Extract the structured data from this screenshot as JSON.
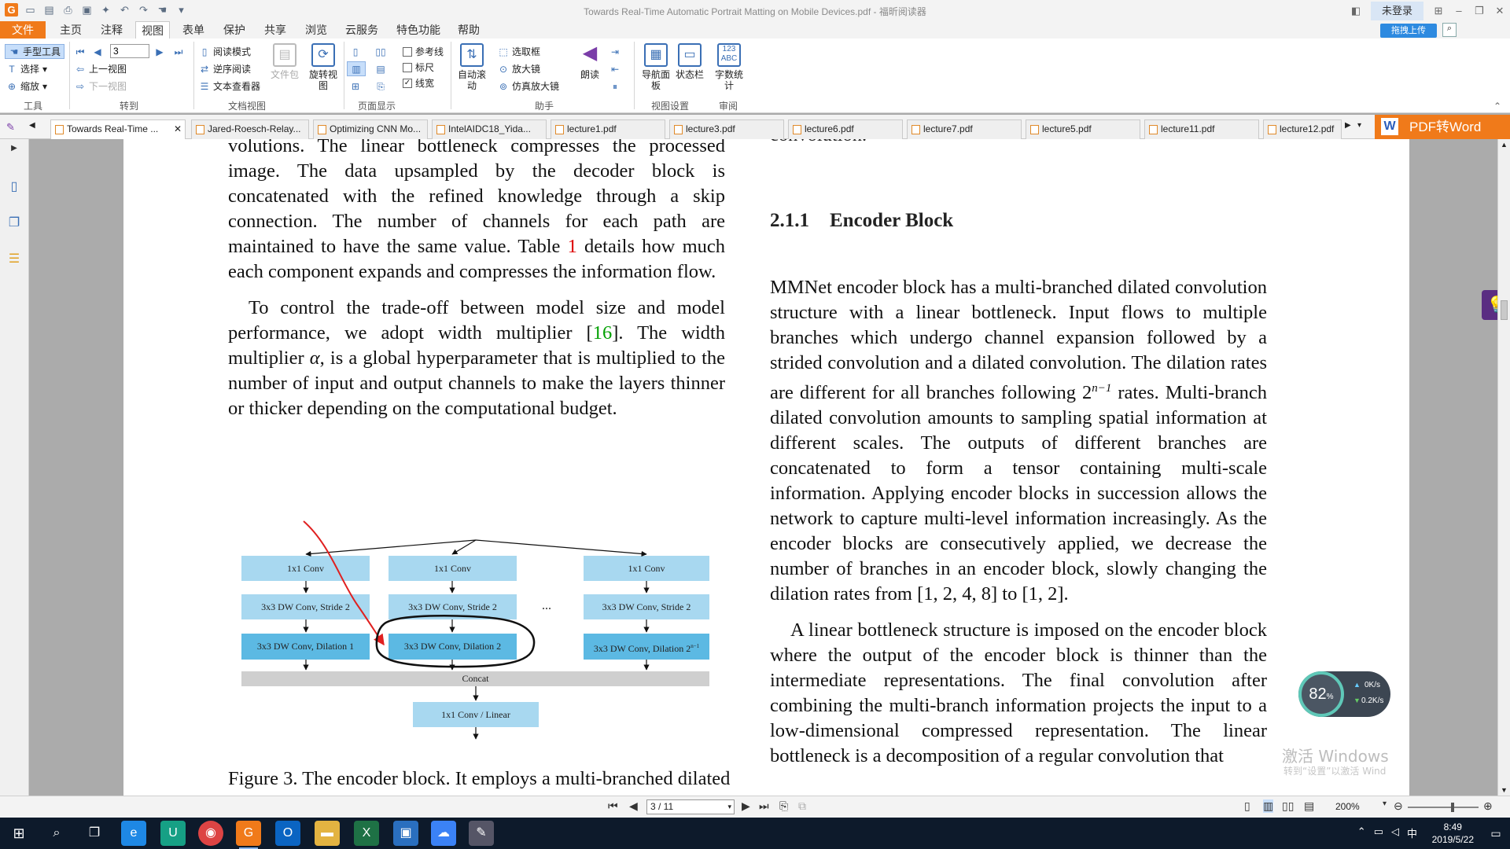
{
  "window": {
    "title": "Towards Real-Time Automatic Portrait Matting on Mobile Devices.pdf - 福昕阅读器",
    "login_label": "未登录",
    "upload_label": "拖拽上传"
  },
  "menu": {
    "tabs": [
      "文件",
      "主页",
      "注释",
      "视图",
      "表单",
      "保护",
      "共享",
      "浏览",
      "云服务",
      "特色功能",
      "帮助"
    ],
    "active": "视图"
  },
  "ribbon": {
    "tools": {
      "hand": "手型工具",
      "select": "选择",
      "zoom": "缩放",
      "group": "工具"
    },
    "goto": {
      "page_value": "3",
      "prev_view": "上一视图",
      "next_view": "下一视图",
      "group": "转到"
    },
    "docview": {
      "read_mode": "阅读模式",
      "reverse_read": "逆序阅读",
      "text_viewer": "文本查看器",
      "file_pkg": "文件包",
      "rotate": "旋转视图",
      "group": "文档视图"
    },
    "pagedisplay": {
      "guides": "参考线",
      "ruler": "标尺",
      "linewidth": "线宽",
      "group": "页面显示"
    },
    "assist": {
      "auto_scroll": "自动滚动",
      "select_box": "选取框",
      "magnifier": "放大镜",
      "loupe": "仿真放大镜",
      "read_aloud": "朗读",
      "group": "助手"
    },
    "viewsettings": {
      "nav_panel": "导航面板",
      "status_bar": "状态栏",
      "word_count": "字数统计",
      "group": "视图设置",
      "group2": "审阅",
      "abc": "123 ABC"
    }
  },
  "doc_tabs": [
    "Towards Real-Time ...",
    "Jared-Roesch-Relay...",
    "Optimizing CNN Mo...",
    "IntelAIDC18_Yida...",
    "lecture1.pdf",
    "lecture3.pdf",
    "lecture6.pdf",
    "lecture7.pdf",
    "lecture5.pdf",
    "lecture11.pdf",
    "lecture12.pdf"
  ],
  "pdf_to_word": "PDF转Word",
  "document": {
    "left_para1": [
      "volutions. The linear bottleneck compresses the processed image. The data upsampled by the decoder block is concatenated with the refined knowledge through a skip connection. The number of channels for each path are maintained to have the same value. Table ",
      "1",
      " details how much each component expands and compresses the information flow."
    ],
    "left_para2": [
      "To control the trade-off between model size and model performance, we adopt width multiplier [",
      "16",
      "]. The width multiplier ",
      "α",
      ", is a global hyperparameter that is multiplied to the number of input and output channels to make the layers thinner or thicker depending on the computational budget."
    ],
    "top_fragment": "convolution.",
    "heading_num": "2.1.1",
    "heading_text": "Encoder Block",
    "right_para1_a": "MMNet encoder block has a multi-branched dilated convolution structure with a linear bottleneck. Input flows to multiple branches which undergo channel expansion followed by a strided convolution and a dilated convolution. The dilation rates are different for all branches following ",
    "right_para1_exp_base": "2",
    "right_para1_exp": "n−1",
    "right_para1_b": " rates. Multi-branch dilated convolution amounts to sampling spatial information at different scales. The outputs of different branches are concatenated to form a tensor containing multi-scale information. Applying encoder blocks in succession allows the network to capture multi-level information increasingly. As the encoder blocks are consecutively applied, we decrease the number of branches in an encoder block, slowly changing the dilation rates from [1, 2, 4, 8] to [1, 2].",
    "right_para2": "A linear bottleneck structure is imposed on the encoder block where the output of the encoder block is thinner than the intermediate representations. The final convolution after combining the multi-branch information projects the input to a low-dimensional compressed representation. The linear bottleneck is a decomposition of a regular convolution that",
    "figure_caption": "Figure 3. The encoder block. It employs a multi-branched dilated"
  },
  "diagram": {
    "conv1x1": "1x1 Conv",
    "dwstride": "3x3 DW Conv, Stride 2",
    "dil1": "3x3 DW Conv, Dilation 1",
    "dil2": "3x3 DW Conv, Dilation 2",
    "dil3_base": "3x3 DW Conv, Dilation 2",
    "dil3_sup": "n−1",
    "ellipsis": "...",
    "concat": "Concat",
    "linear": "1x1 Conv / Linear",
    "colors": {
      "light": "#a8d8f0",
      "dark": "#5cb9e3",
      "concat": "#cfcfcf",
      "annotation_red": "#e02020",
      "annotation_black": "#111111"
    }
  },
  "status": {
    "page_field": "3 / 11",
    "zoom": "200%"
  },
  "netmon": {
    "cpu": "82",
    "unit": "%",
    "up": "0K/s",
    "down": "0.2K/s"
  },
  "watermark": {
    "line1": "激活 Windows",
    "line2": "转到“设置”以激活 Wind"
  },
  "taskbar": {
    "time": "8:49",
    "date": "2019/5/22",
    "ime": "中"
  }
}
